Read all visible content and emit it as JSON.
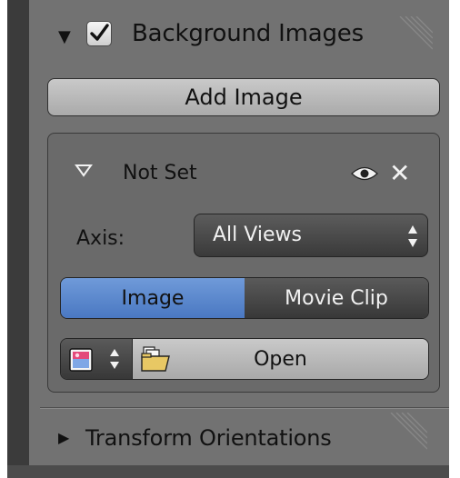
{
  "panel": {
    "background_images": {
      "label": "Background Images",
      "checked": true,
      "add_image_label": "Add Image",
      "slot": {
        "name": "Not Set",
        "axis_label": "Axis:",
        "axis_value": "All Views",
        "source_options": [
          "Image",
          "Movie Clip"
        ],
        "source_selected": "Image",
        "open_label": "Open"
      }
    },
    "transform_orientations": {
      "label": "Transform Orientations"
    }
  },
  "icons": [
    "chevron-down-icon",
    "checkbox-icon",
    "grip-icon",
    "triangle-down-icon",
    "eye-icon",
    "close-icon",
    "image-browse-icon",
    "folder-icon",
    "chevron-right-icon"
  ],
  "colors": {
    "panel_bg": "#727272",
    "accent_blue": "#5585cf",
    "dark_button": "#444444"
  }
}
